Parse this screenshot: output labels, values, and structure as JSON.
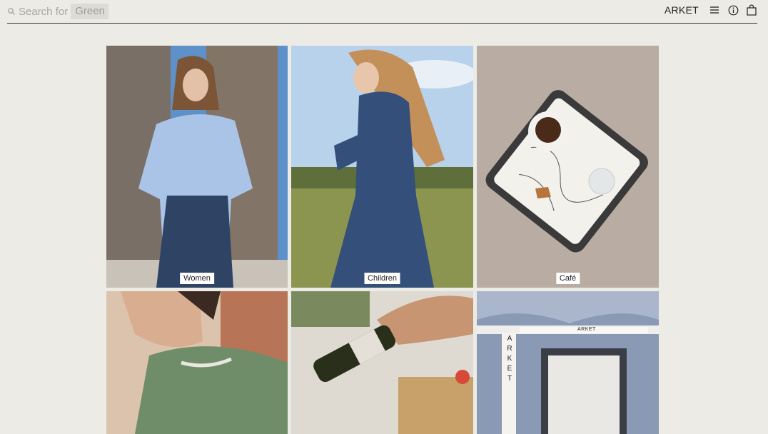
{
  "header": {
    "search": {
      "prefix": "Search for",
      "value": "Green"
    },
    "brand": "ARKET",
    "icons": {
      "search": "search-icon",
      "menu": "menu-icon",
      "info": "info-icon",
      "bag": "shopping-bag-icon"
    }
  },
  "tiles": [
    {
      "label": "Women"
    },
    {
      "label": "Children"
    },
    {
      "label": "Café"
    }
  ],
  "storefront": {
    "sign": "ARKET",
    "vertical_sign": "ARKET"
  }
}
